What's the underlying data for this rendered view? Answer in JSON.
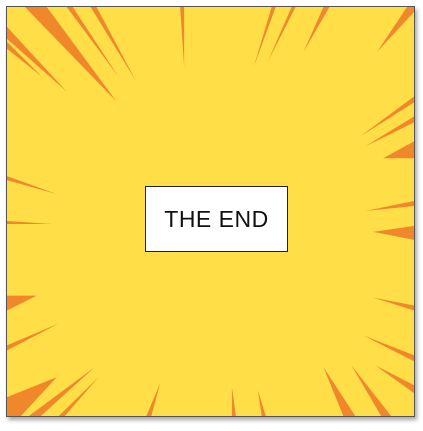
{
  "panel": {
    "caption": "THE END",
    "background_color": "#FFDE47",
    "ray_color": "#F0872B"
  }
}
